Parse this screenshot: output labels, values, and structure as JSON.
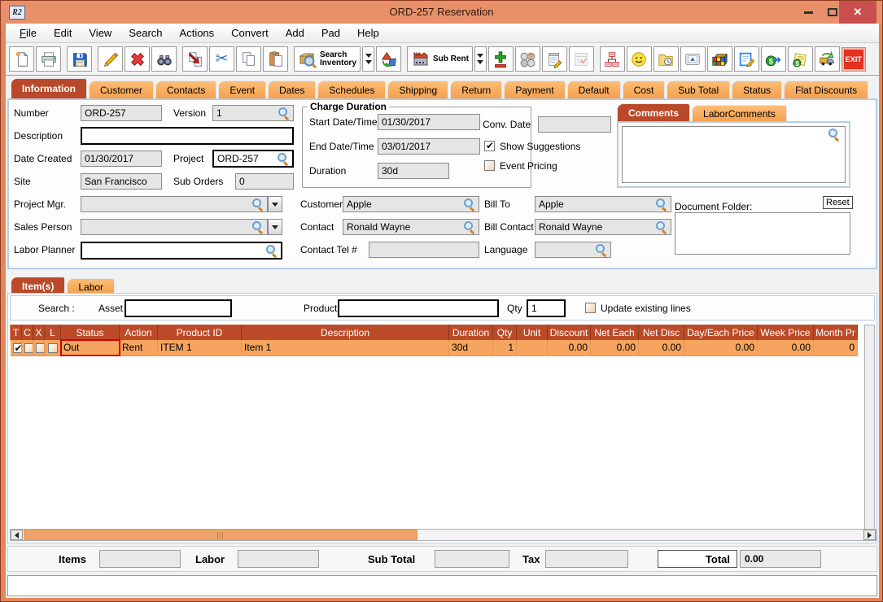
{
  "window": {
    "title": "ORD-257 Reservation",
    "app_icon_label": "R2"
  },
  "menu": {
    "items": [
      "File",
      "Edit",
      "View",
      "Search",
      "Actions",
      "Convert",
      "Add",
      "Pad",
      "Help"
    ]
  },
  "toolbar": {
    "icons": [
      "new-document",
      "print",
      "save",
      "edit-pencil",
      "delete",
      "find-binoculars",
      "copy-order",
      "cut",
      "copy",
      "paste",
      "search-inventory",
      "search-inventory-more",
      "shapes",
      "sub-rent",
      "sub-rent-more",
      "add-remove-line",
      "spheres-query",
      "notepad-edit",
      "calendar-disabled",
      "org-chart",
      "smiley",
      "folder-history",
      "keyboard-key",
      "inventory-cubes",
      "note-edit",
      "dollar-forward",
      "dollar-note",
      "delivery-truck",
      "exit"
    ],
    "search_inventory": {
      "line1": "Search",
      "line2": "Inventory"
    },
    "sub_rent_label": "Sub Rent",
    "exit_label": "EXIT"
  },
  "tabs": {
    "active_index": 0,
    "items": [
      "Information",
      "Customer",
      "Contacts",
      "Event",
      "Dates",
      "Schedules",
      "Shipping",
      "Return",
      "Payment",
      "Default",
      "Cost",
      "Sub Total",
      "Status",
      "Flat Discounts"
    ]
  },
  "info": {
    "number_label": "Number",
    "number_value": "ORD-257",
    "version_label": "Version",
    "version_value": "1",
    "description_label": "Description",
    "description_value": "",
    "date_created_label": "Date Created",
    "date_created_value": "01/30/2017",
    "project_label": "Project",
    "project_value": "ORD-257",
    "site_label": "Site",
    "site_value": "San Francisco",
    "sub_orders_label": "Sub Orders",
    "sub_orders_value": "0",
    "project_mgr_label": "Project Mgr.",
    "project_mgr_value": "",
    "sales_person_label": "Sales Person",
    "sales_person_value": "",
    "labor_planner_label": "Labor Planner",
    "labor_planner_value": "",
    "charge_duration": {
      "title": "Charge Duration",
      "start_label": "Start Date/Time",
      "start_value": "01/30/2017",
      "end_label": "End Date/Time",
      "end_value": "03/01/2017",
      "duration_label": "Duration",
      "duration_value": "30d"
    },
    "conv_date_label": "Conv. Date",
    "conv_date_value": "",
    "show_suggestions_label": "Show Suggestions",
    "show_suggestions_checked": true,
    "event_pricing_label": "Event Pricing",
    "event_pricing_checked": false,
    "customer_label": "Customer",
    "customer_value": "Apple",
    "bill_to_label": "Bill To",
    "bill_to_value": "Apple",
    "contact_label": "Contact",
    "contact_value": "Ronald Wayne",
    "bill_contact_label": "Bill Contact",
    "bill_contact_value": "Ronald Wayne",
    "contact_tel_label": "Contact Tel #",
    "contact_tel_value": "",
    "language_label": "Language",
    "language_value": "",
    "comments_tabs": {
      "items": [
        "Comments",
        "LaborComments"
      ],
      "active_index": 0
    },
    "comments_value": "",
    "document_folder_label": "Document Folder:",
    "reset_label": "Reset",
    "document_folder_value": ""
  },
  "items_section": {
    "tabs": {
      "items": [
        "Item(s)",
        "Labor"
      ],
      "active_index": 0
    },
    "search": {
      "label": "Search :",
      "asset_label": "Asset",
      "asset_value": "",
      "product_label": "Product",
      "product_value": "",
      "qty_label": "Qty",
      "qty_value": "1",
      "update_existing_label": "Update existing lines",
      "update_existing_checked": false
    },
    "table": {
      "columns": [
        "T",
        "C",
        "X",
        "L",
        "Status",
        "Action",
        "Product ID",
        "Description",
        "Duration",
        "Qty",
        "Unit",
        "Discount",
        "Net Each",
        "Net Disc",
        "Day/Each Price",
        "Week Price",
        "Month Pr"
      ],
      "rows": [
        {
          "t_checked": true,
          "c_checked": false,
          "x_checked": false,
          "l_checked": false,
          "status": "Out",
          "action": "Rent",
          "product_id": "ITEM 1",
          "description": "Item 1",
          "duration": "30d",
          "qty": "1",
          "unit": "",
          "discount": "0.00",
          "net_each": "0.00",
          "net_disc": "0.00",
          "day_each_price": "0.00",
          "week_price": "0.00",
          "month_price": "0"
        }
      ]
    }
  },
  "totals": {
    "items_label": "Items",
    "items_value": "",
    "labor_label": "Labor",
    "labor_value": "",
    "sub_total_label": "Sub Total",
    "sub_total_value": "",
    "tax_label": "Tax",
    "tax_value": "",
    "total_label": "Total",
    "total_value": "0.00"
  }
}
